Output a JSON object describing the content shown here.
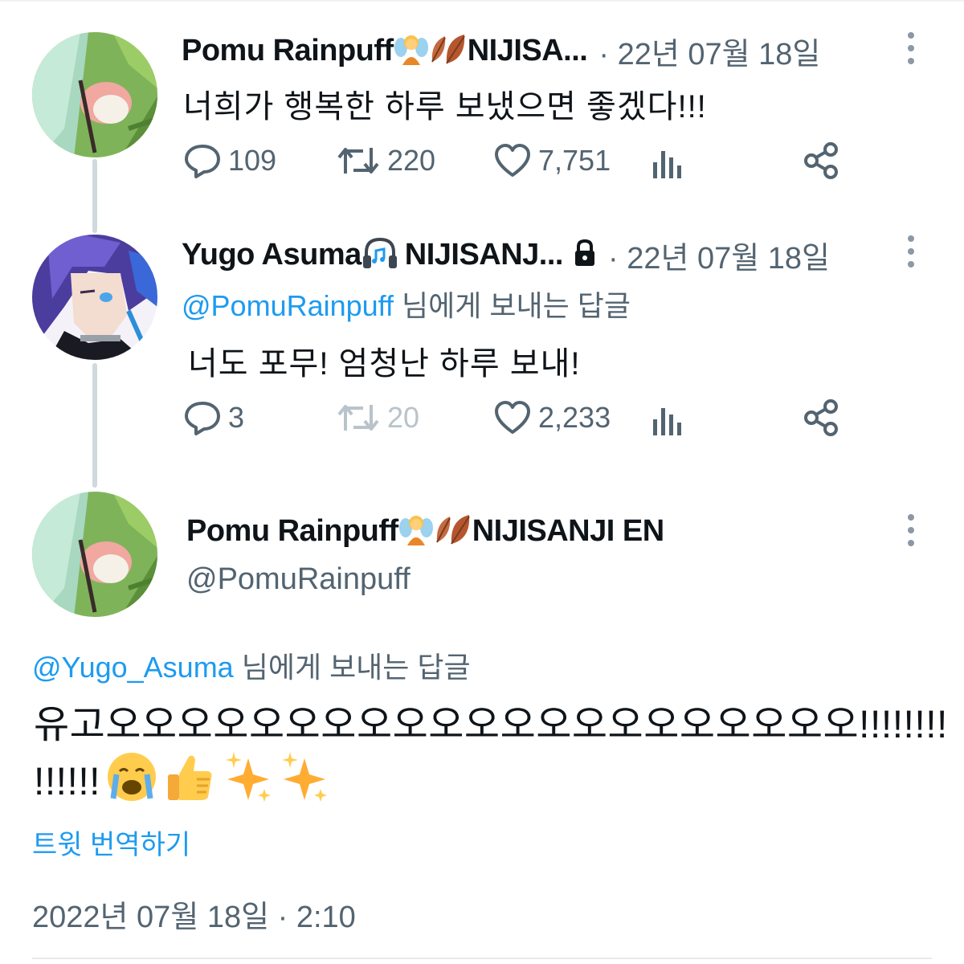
{
  "tweets": [
    {
      "name": "Pomu Rainpuff",
      "name_suffix": "NIJISA...",
      "meta": "· 22년 07월 18일",
      "text": "너희가 행복한 하루 보냈으면 좋겠다!!!",
      "replies": "109",
      "retweets": "220",
      "likes": "7,751"
    },
    {
      "name": "Yugo Asuma",
      "name_suffix": "NIJISANJ...",
      "meta": "· 22년 07월 18일",
      "reply_mention": "@PomuRainpuff",
      "reply_suffix": " 님에게 보내는 답글",
      "text": "너도 포무! 엄청난 하루 보내!",
      "replies": "3",
      "retweets": "20",
      "likes": "2,233"
    }
  ],
  "main_tweet": {
    "name": "Pomu Rainpuff",
    "name_suffix": "NIJISANJI EN",
    "handle": "@PomuRainpuff",
    "reply_mention": "@Yugo_Asuma",
    "reply_suffix": " 님에게 보내는 답글",
    "text_line1": "유고오오오오오오오오오오오오오오오오오오오오오!!!!!!!!",
    "text_line2": "!!!!!!",
    "translate": "트윗 번역하기",
    "timestamp": "2022년 07월 18일 · 2:10"
  },
  "icons": {
    "reply": "reply-bubble-icon",
    "retweet": "retweet-icon",
    "like": "heart-icon",
    "views": "views-chart-icon",
    "share": "share-icon",
    "more": "more-vertical-icon",
    "lock": "lock-icon",
    "fairy": "fairy-emoji",
    "leaves": "leaves-emoji",
    "headphones": "headphones-emoji",
    "crying": "crying-emoji",
    "thumbs_up": "thumbs-up-emoji",
    "sparkles": "sparkles-emoji"
  },
  "colors": {
    "link": "#1d9bf0",
    "muted": "#536471",
    "text": "#0f1419",
    "thread_line": "#cfd9de"
  }
}
